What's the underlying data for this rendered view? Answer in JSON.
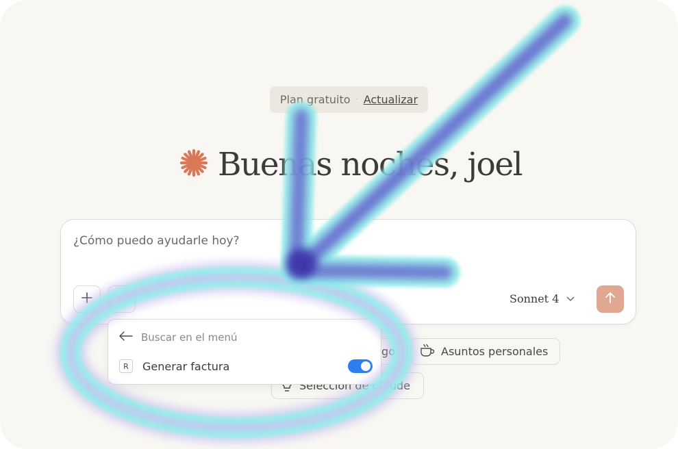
{
  "plan": {
    "label": "Plan gratuito",
    "separator": "·",
    "upgrade": "Actualizar"
  },
  "greeting": {
    "text": "Buenas noches, joel"
  },
  "composer": {
    "placeholder": "¿Cómo puedo ayudarle hoy?",
    "model": "Sonnet 4"
  },
  "chips": {
    "partial_label": "go",
    "personal": "Asuntos personales",
    "claude_choice": "Selección de Claude"
  },
  "menu": {
    "search_placeholder": "Buscar en el menú",
    "item_badge": "R",
    "item_label": "Generar factura",
    "item_enabled": true
  },
  "colors": {
    "background": "#f9f7f3",
    "accent_star": "#d97757",
    "send": "#e0a890",
    "toggle_on": "#2d7ff0",
    "arrow": "#4a3fb5",
    "glow": "#8ff0ea"
  },
  "icons": [
    "star-logo-icon",
    "plus-icon",
    "chevron-down-icon",
    "arrow-up-icon",
    "arrow-left-icon",
    "cup-icon",
    "lightbulb-icon"
  ]
}
